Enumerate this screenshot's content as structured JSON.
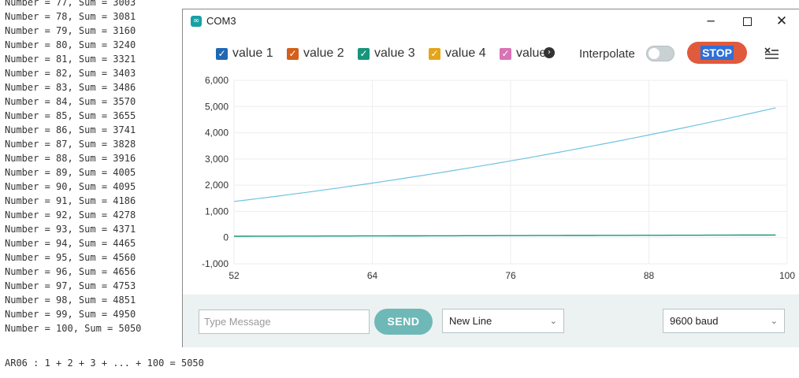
{
  "console": {
    "lines": [
      "Number = 77, Sum = 3003",
      "Number = 78, Sum = 3081",
      "Number = 79, Sum = 3160",
      "Number = 80, Sum = 3240",
      "Number = 81, Sum = 3321",
      "Number = 82, Sum = 3403",
      "Number = 83, Sum = 3486",
      "Number = 84, Sum = 3570",
      "Number = 85, Sum = 3655",
      "Number = 86, Sum = 3741",
      "Number = 87, Sum = 3828",
      "Number = 88, Sum = 3916",
      "Number = 89, Sum = 4005",
      "Number = 90, Sum = 4095",
      "Number = 91, Sum = 4186",
      "Number = 92, Sum = 4278",
      "Number = 93, Sum = 4371",
      "Number = 94, Sum = 4465",
      "Number = 95, Sum = 4560",
      "Number = 96, Sum = 4656",
      "Number = 97, Sum = 4753",
      "Number = 98, Sum = 4851",
      "Number = 99, Sum = 4950",
      "Number = 100, Sum = 5050"
    ],
    "footer": "AR06 : 1 + 2 + 3 + ... + 100 = 5050"
  },
  "window": {
    "title": "COM3",
    "app_icon": "arduino-infinity-icon",
    "controls": {
      "minimize": "─",
      "maximize": "",
      "close": "✕"
    }
  },
  "toolbar": {
    "legend": [
      {
        "label": "value 1",
        "color": "#1f67b3",
        "checked": true
      },
      {
        "label": "value 2",
        "color": "#d35f1a",
        "checked": true
      },
      {
        "label": "value 3",
        "color": "#17957b",
        "checked": true
      },
      {
        "label": "value 4",
        "color": "#e4a51b",
        "checked": true
      },
      {
        "label": "value 5",
        "color": "#d873b5",
        "checked": true
      }
    ],
    "more_icon": "chevron-right-circle-icon",
    "interpolate_label": "Interpolate",
    "interpolate_on": false,
    "stop_label": "STOP",
    "clear_icon": "clear-list-icon"
  },
  "chart_data": {
    "type": "line",
    "x": [
      52,
      100
    ],
    "xlim": [
      52,
      100
    ],
    "ylim": [
      -1000,
      6000
    ],
    "x_ticks": [
      "52",
      "64",
      "76",
      "88",
      "100"
    ],
    "y_ticks": [
      "6,000",
      "5,000",
      "4,000",
      "3,000",
      "2,000",
      "1,000",
      "0",
      "-1,000"
    ],
    "grid": true,
    "series": [
      {
        "color": "#6ec3e0",
        "x_start": 52,
        "x_end": 99,
        "formula": "n(n+1)/2",
        "values_note_start": 1378,
        "values_note_end": 4950
      },
      {
        "color": "#17957b",
        "x_start": 52,
        "x_end": 99,
        "formula": "n"
      }
    ]
  },
  "bottom": {
    "message_placeholder": "Type Message",
    "send_label": "SEND",
    "line_ending": "New Line",
    "baud_rate": "9600 baud"
  }
}
